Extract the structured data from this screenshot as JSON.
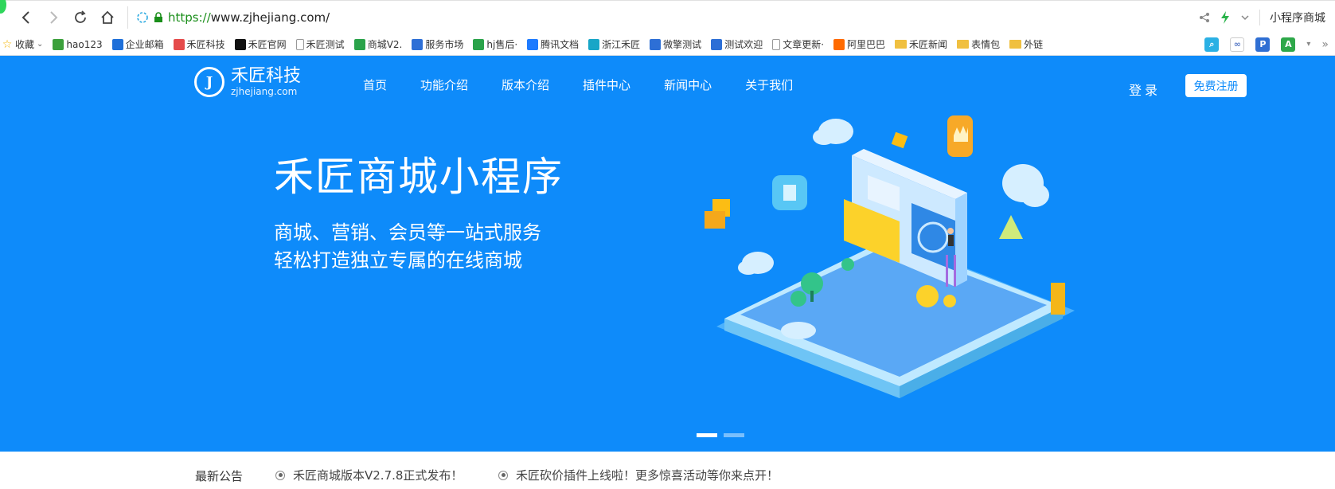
{
  "browser": {
    "url_scheme": "https://",
    "url_rest": "www.zjhejiang.com/",
    "search_engine": "小程序商城"
  },
  "bookmarks": [
    {
      "label": "收藏",
      "icon": "star-icon",
      "color": "#f5b400"
    },
    {
      "label": "hao123",
      "icon": "hao123-icon",
      "color": "#3ca03c"
    },
    {
      "label": "企业邮箱",
      "icon": "mail-icon",
      "color": "#1e6fd9"
    },
    {
      "label": "禾匠科技",
      "icon": "windows-icon",
      "color": "#e54b4b"
    },
    {
      "label": "禾匠官网",
      "icon": "hejiang-icon",
      "color": "#111111"
    },
    {
      "label": "禾匠测试",
      "icon": "page-icon",
      "color": "#999999"
    },
    {
      "label": "商城V2.",
      "icon": "leaf-icon",
      "color": "#2aa34a"
    },
    {
      "label": "服务市场",
      "icon": "m-icon",
      "color": "#2d6fd6"
    },
    {
      "label": "hj售后·",
      "icon": "leaf-icon",
      "color": "#2aa34a"
    },
    {
      "label": "腾讯文档",
      "icon": "tencent-docs-icon",
      "color": "#1e7bff"
    },
    {
      "label": "浙江禾匠",
      "icon": "bird-icon",
      "color": "#18a6c7"
    },
    {
      "label": "微擎测试",
      "icon": "m-icon",
      "color": "#2d6fd6"
    },
    {
      "label": "测试欢迎",
      "icon": "m-icon",
      "color": "#2d6fd6"
    },
    {
      "label": "文章更新·",
      "icon": "page-icon",
      "color": "#999999"
    },
    {
      "label": "阿里巴巴",
      "icon": "alibaba-icon",
      "color": "#ff6a00"
    },
    {
      "label": "禾匠新闻",
      "icon": "folder-icon",
      "color": "#f0c040"
    },
    {
      "label": "表情包",
      "icon": "folder-icon",
      "color": "#f0c040"
    },
    {
      "label": "外链",
      "icon": "folder-icon",
      "color": "#f0c040"
    }
  ],
  "site": {
    "logo_name": "禾匠科技",
    "logo_domain": "zjhejiang.com",
    "nav": [
      "首页",
      "功能介绍",
      "版本介绍",
      "插件中心",
      "新闻中心",
      "关于我们"
    ],
    "login": "登录",
    "register": "免费注册",
    "hero_title": "禾匠商城小程序",
    "hero_line1": "商城、营销、会员等一站式服务",
    "hero_line2": "轻松打造独立专属的在线商城",
    "notice_label": "最新公告",
    "notices": [
      "禾匠商城版本V2.7.8正式发布！",
      "禾匠砍价插件上线啦！更多惊喜活动等你来点开！"
    ],
    "brand_color": "#0e8bfa"
  }
}
